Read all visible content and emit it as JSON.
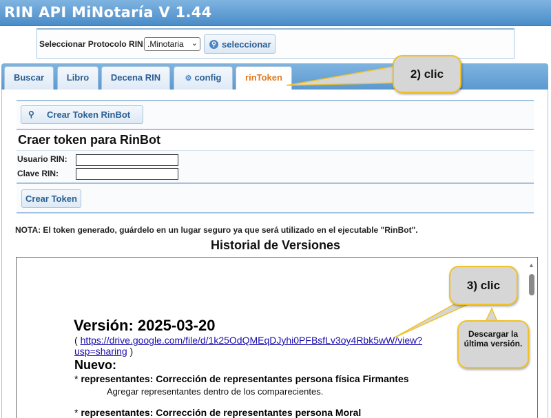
{
  "app": {
    "title": "RIN API MiNotaría V 1.44"
  },
  "protocol": {
    "label": "Seleccionar Protocolo RIN:",
    "selected": ".Minotaria",
    "button_label": "seleccionar"
  },
  "tabs": [
    {
      "label": "Buscar"
    },
    {
      "label": "Libro"
    },
    {
      "label": "Decena RIN"
    },
    {
      "label": "config"
    },
    {
      "label": "rinToken"
    }
  ],
  "token_panel": {
    "create_bot_button": "Crear Token RinBot",
    "heading": "Craer token para RinBot",
    "user_label": "Usuario RIN:",
    "user_value": "",
    "password_label": "Clave RIN:",
    "password_value": "",
    "create_button": "Crear Token"
  },
  "note": "NOTA: El token generado, guárdelo en un lugar seguro ya que será utilizado en el ejecutable \"RinBot\".",
  "history": {
    "title": "Historial de Versiones",
    "version": "Versión: 2025-03-20",
    "link_open": "( ",
    "link_url": "https://drive.google.com/file/d/1k25OdQMEqDJyhi0PFBsfLv3oy4Rbk5wW/view?usp=sharing",
    "link_close": " )",
    "new_heading": "Nuevo:",
    "bullet_prefix": "* ",
    "item1_title": "representantes: Corrección de representantes persona física Firmantes",
    "item1_desc": "Agregar representantes dentro de los comparecientes.",
    "item2_title": "representantes: Corrección de representantes persona Moral"
  },
  "callouts": {
    "step2": "2) clic",
    "step3": "3) clic",
    "download": "Descargar la última versión."
  },
  "colors": {
    "title_bar": "#4a8cc8",
    "active_tab_text": "#e07a1f",
    "button_text": "#2b5f94",
    "callout_fill": "#d6d6d6",
    "callout_border": "#f0c227",
    "link": "#1a0dab"
  }
}
